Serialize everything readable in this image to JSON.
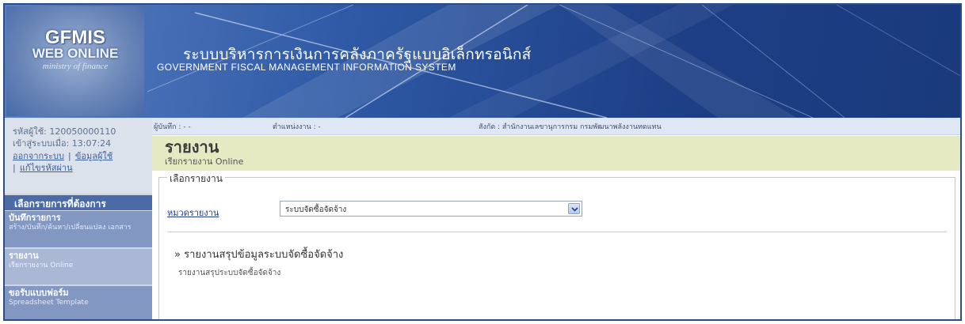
{
  "header": {
    "logo_main": "GFMIS",
    "logo_web": "WEB ONLINE",
    "logo_sub": "ministry of finance",
    "title_th": "ระบบบริหารการเงินการคลังภาครัฐแบบอิเล็กทรอนิกส์",
    "title_en": "GOVERNMENT FISCAL MANAGEMENT INFORMATION SYSTEM"
  },
  "user": {
    "user_id": "รหัสผู้ใช้: 120050000110",
    "login_time": "เข้าสู่ระบบเมื่อ: 13:07:24",
    "logout_link": "ออกจากระบบ",
    "separator": "|",
    "user_info_link": "ข้อมูลผู้ใช้",
    "change_password_link": "แก้ไขรหัสผ่าน"
  },
  "menu": {
    "header": "เลือกรายการที่ต้องการ",
    "items": [
      {
        "title": "บันทึกรายการ",
        "desc": "สร้าง/บันทึก/ค้นหา/เปลี่ยนแปลง เอกสาร"
      },
      {
        "title": "รายงาน",
        "desc": "เรียกรายงาน Online"
      },
      {
        "title": "ขอรับแบบฟอร์ม",
        "desc": "Spreadsheet Template"
      }
    ]
  },
  "infobar": {
    "recorder": "ผู้บันทึก : - -",
    "position": "ตำแหน่งงาน : -",
    "affiliation": "สังกัด : สำนักงานเลขานุการกรม กรมพัฒนาพลังงานทดแทน"
  },
  "page": {
    "title": "รายงาน",
    "subtitle": "เรียกรายงาน Online"
  },
  "report": {
    "group_legend": "เลือกรายงาน",
    "category_label": "หมวดรายงาน",
    "category_value": "ระบบจัดซื้อจัดจ้าง",
    "report_title": "» รายงานสรุปข้อมูลระบบจัดซื้อจัดจ้าง",
    "report_desc": "รายงานสรุประบบจัดซื้อจัดจ้าง"
  }
}
